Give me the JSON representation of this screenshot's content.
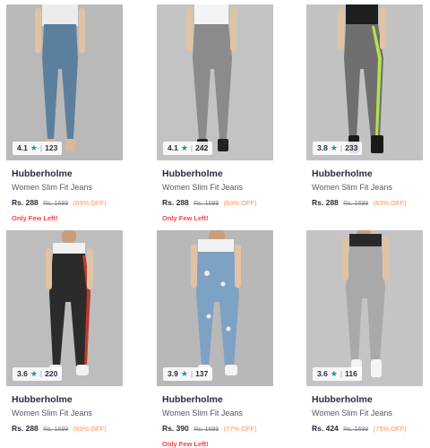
{
  "products": [
    {
      "rating": "4.1",
      "count": "123",
      "brand": "Hubberholme",
      "title": "Women Slim Fit Jeans",
      "price": "Rs. 288",
      "mrp": "Rs. 1699",
      "discount": "(83% OFF)",
      "stock": "Only Few Left!",
      "wash": "#5d7f9e",
      "bg": "#b9b9b9",
      "top": "#ececec",
      "shoe": "#d8b99a",
      "stripe": ""
    },
    {
      "rating": "4.1",
      "count": "242",
      "brand": "Hubberholme",
      "title": "Women Slim Fit Jeans",
      "price": "Rs. 288",
      "mrp": "Rs. 1699",
      "discount": "(83% OFF)",
      "stock": "Only Few Left!",
      "wash": "#8b8b8b",
      "bg": "#c3c3c3",
      "top": "#f4f4f4",
      "shoe": "#222222",
      "stripe": ""
    },
    {
      "rating": "3.8",
      "count": "233",
      "brand": "Hubberholme",
      "title": "Women Slim Fit Jeans",
      "price": "Rs. 288",
      "mrp": "Rs. 1699",
      "discount": "(83% OFF)",
      "stock": "",
      "wash": "#6f6f6f",
      "bg": "#c2c2c2",
      "top": "#1e1e1e",
      "shoe": "#1a1a1a",
      "stripe": "#b7e04a"
    },
    {
      "rating": "3.6",
      "count": "220",
      "brand": "Hubberholme",
      "title": "Women Slim Fit Jeans",
      "price": "Rs. 288",
      "mrp": "Rs. 1699",
      "discount": "(83% OFF)",
      "stock": "",
      "wash": "#2b2b2b",
      "bg": "#bdbdbd",
      "top": "#f1f1f1",
      "shoe": "#f2f2f2",
      "stripe": "#c0392b"
    },
    {
      "rating": "3.9",
      "count": "137",
      "brand": "Hubberholme",
      "title": "Women Slim Fit Jeans",
      "price": "Rs. 390",
      "mrp": "Rs. 1699",
      "discount": "(77% OFF)",
      "stock": "Only Few Left!",
      "wash": "#7ea2c4",
      "bg": "#b8b8b8",
      "top": "#f2f2f2",
      "shoe": "#f4f4f4",
      "stripe": ""
    },
    {
      "rating": "3.6",
      "count": "116",
      "brand": "Hubberholme",
      "title": "Women Slim Fit Jeans",
      "price": "Rs. 424",
      "mrp": "Rs. 1699",
      "discount": "(75% OFF)",
      "stock": "",
      "wash": "#a9a9a9",
      "bg": "#c4c4c4",
      "top": "#2a2a2a",
      "shoe": "#f4f4f4",
      "stripe": ""
    }
  ],
  "icons": {
    "rating_star": "star-icon",
    "rating_separator": "|"
  }
}
